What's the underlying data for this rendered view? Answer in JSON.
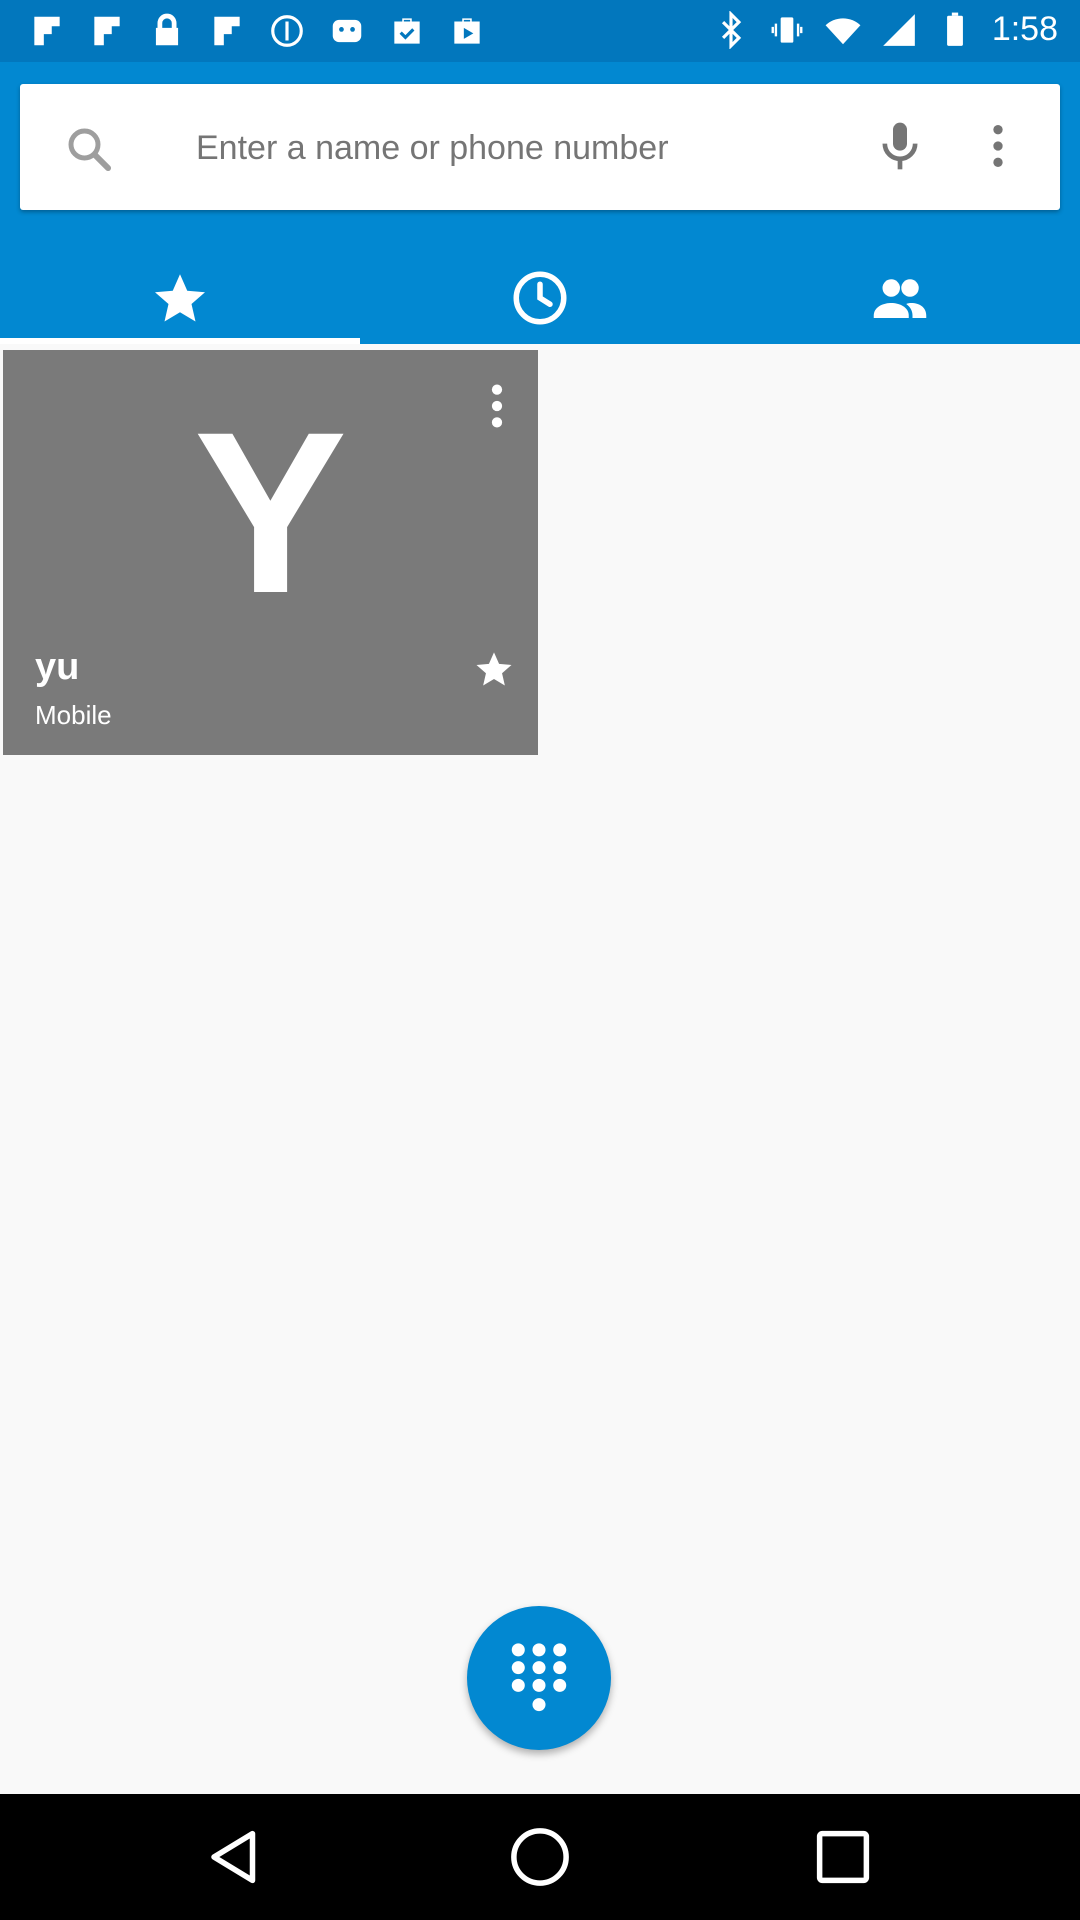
{
  "status_bar": {
    "time": "1:58",
    "left_icons": [
      "flipboard-icon",
      "flipboard-icon",
      "lock-icon",
      "flipboard-icon",
      "info-icon",
      "android-icon",
      "briefcase-check-icon",
      "play-store-icon"
    ],
    "right_icons": [
      "bluetooth-icon",
      "vibrate-icon",
      "wifi-icon",
      "signal-icon",
      "battery-icon"
    ]
  },
  "search": {
    "placeholder": "Enter a name or phone number",
    "value": ""
  },
  "tabs": [
    {
      "name": "favorites",
      "icon": "star-icon",
      "active": true
    },
    {
      "name": "recents",
      "icon": "clock-icon",
      "active": false
    },
    {
      "name": "contacts",
      "icon": "people-icon",
      "active": false
    }
  ],
  "favorite_card": {
    "letter": "Y",
    "name": "yu",
    "type": "Mobile",
    "starred": true
  },
  "colors": {
    "status_bar": "#0277bd",
    "app_bar": "#0288d1",
    "card": "#7a7a7a",
    "background": "#f9f9f9"
  }
}
